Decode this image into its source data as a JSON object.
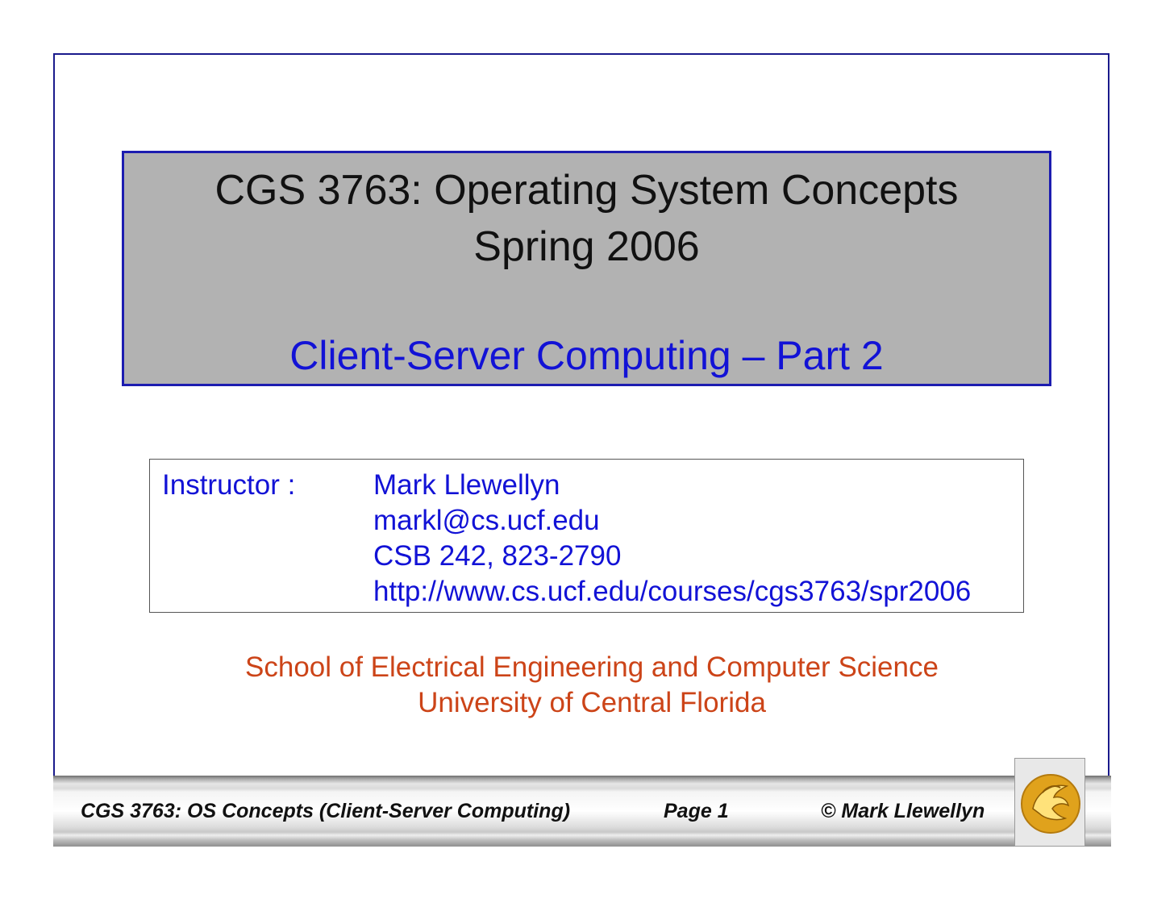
{
  "title": {
    "line1": "CGS 3763: Operating System Concepts",
    "line2": "Spring 2006",
    "subtitle": "Client-Server Computing – Part 2"
  },
  "instructor": {
    "label": "Instructor :",
    "name": "Mark Llewellyn",
    "email": "markl@cs.ucf.edu",
    "office": "CSB 242, 823-2790",
    "url": "http://www.cs.ucf.edu/courses/cgs3763/spr2006"
  },
  "school": {
    "line1": "School of Electrical Engineering and Computer Science",
    "line2": "University of Central Florida"
  },
  "footer": {
    "course": "CGS 3763: OS Concepts  (Client-Server Computing)",
    "page": "Page 1",
    "copyright": "© Mark Llewellyn",
    "logo_icon": "ucf-pegasus-logo-icon"
  },
  "colors": {
    "title_bg": "#b2b2b2",
    "title_border": "#1c1cb0",
    "blue_text": "#1212d6",
    "orange_text": "#cc4418",
    "logo_gold": "#e0a21c"
  }
}
